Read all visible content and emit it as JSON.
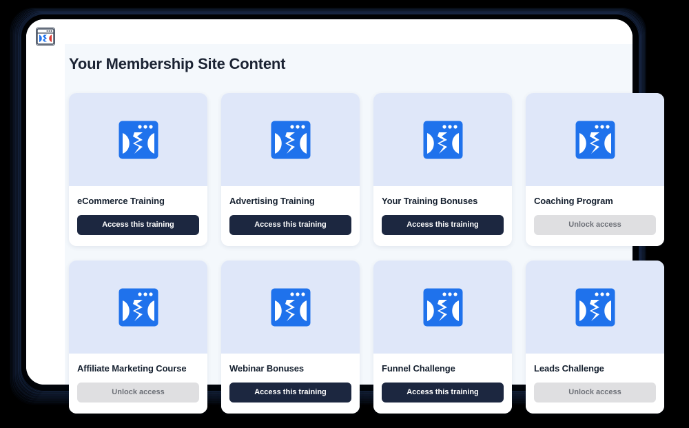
{
  "window": {
    "brand_logo_icon": "browser-window-logo-icon",
    "background_color": "#000000",
    "device_background": "#ffffff",
    "canvas_background": "#f4f8fc"
  },
  "page": {
    "title": "Your Membership Site Content"
  },
  "colors": {
    "accent_blue": "#1f72ec",
    "thumb_background": "#dfe7f9",
    "button_dark": "#1c2740",
    "button_locked": "#dfdfe1",
    "button_locked_text": "#6d7077",
    "title_text": "#15202f"
  },
  "labels": {
    "access": "Access this training",
    "locked": "Unlock access"
  },
  "cards": [
    {
      "title": "eCommerce Training",
      "button": "Access this training",
      "state": "unlocked",
      "icon": "browser-window-icon"
    },
    {
      "title": "Advertising Training",
      "button": "Access this training",
      "state": "unlocked",
      "icon": "browser-window-icon"
    },
    {
      "title": "Your Training Bonuses",
      "button": "Access this training",
      "state": "unlocked",
      "icon": "browser-window-icon"
    },
    {
      "title": "Coaching Program",
      "button": "Unlock access",
      "state": "locked",
      "icon": "browser-window-icon"
    },
    {
      "title": "Affiliate Marketing Course",
      "button": "Unlock access",
      "state": "locked",
      "icon": "browser-window-icon"
    },
    {
      "title": "Webinar Bonuses",
      "button": "Access this training",
      "state": "unlocked",
      "icon": "browser-window-icon"
    },
    {
      "title": "Funnel Challenge",
      "button": "Access this training",
      "state": "unlocked",
      "icon": "browser-window-icon"
    },
    {
      "title": "Leads Challenge",
      "button": "Unlock access",
      "state": "locked",
      "icon": "browser-window-icon"
    }
  ]
}
